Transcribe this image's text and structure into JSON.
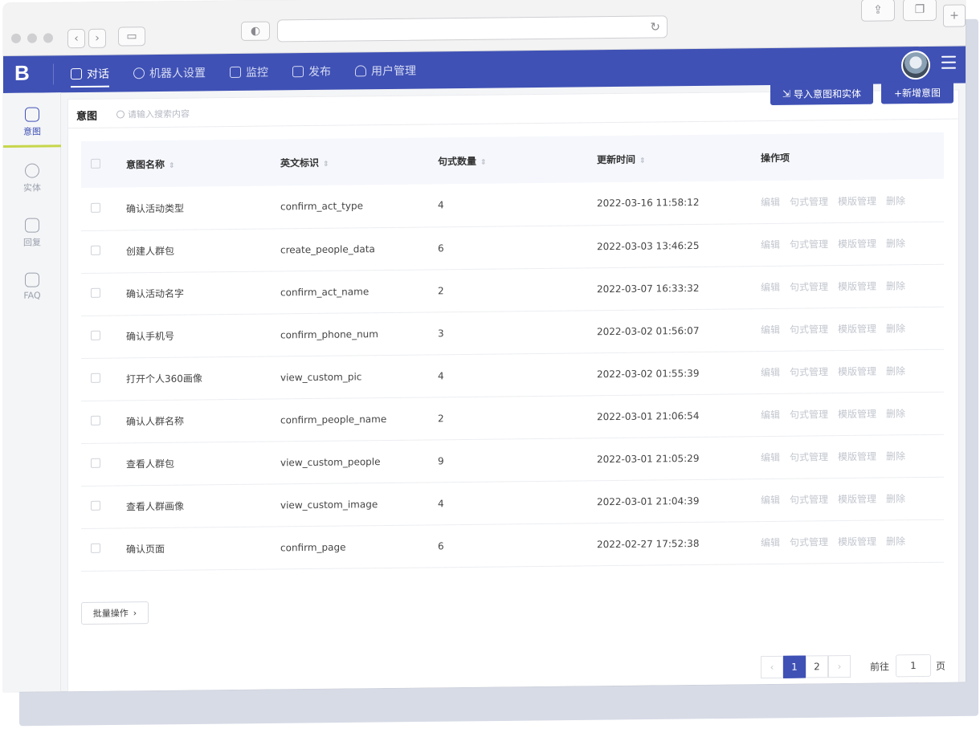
{
  "browser": {
    "address": ""
  },
  "nav": {
    "items": [
      {
        "label": "对话",
        "icon": "chat-icon",
        "active": true
      },
      {
        "label": "机器人设置",
        "icon": "robot-settings-icon",
        "active": false
      },
      {
        "label": "监控",
        "icon": "monitor-icon",
        "active": false
      },
      {
        "label": "发布",
        "icon": "publish-icon",
        "active": false
      },
      {
        "label": "用户管理",
        "icon": "user-icon",
        "active": false
      }
    ]
  },
  "sidebar": {
    "items": [
      {
        "label": "意图",
        "icon": "intent-icon",
        "active": true
      },
      {
        "label": "实体",
        "icon": "entity-icon",
        "active": false
      },
      {
        "label": "回复",
        "icon": "reply-icon",
        "active": false
      },
      {
        "label": "FAQ",
        "icon": "faq-icon",
        "active": false
      }
    ]
  },
  "page": {
    "title": "意图",
    "search_placeholder": "请输入搜索内容",
    "import_button": "导入意图和实体",
    "add_button": "+新增意图",
    "batch_button": "批量操作"
  },
  "table": {
    "headers": {
      "name": "意图名称",
      "english": "英文标识",
      "count": "句式数量",
      "updated": "更新时间",
      "ops": "操作项"
    },
    "op_labels": [
      "编辑",
      "句式管理",
      "模版管理",
      "删除"
    ],
    "rows": [
      {
        "name": "确认活动类型",
        "english": "confirm_act_type",
        "count": "4",
        "updated": "2022-03-16 11:58:12"
      },
      {
        "name": "创建人群包",
        "english": "create_people_data",
        "count": "6",
        "updated": "2022-03-03 13:46:25"
      },
      {
        "name": "确认活动名字",
        "english": "confirm_act_name",
        "count": "2",
        "updated": "2022-03-07 16:33:32"
      },
      {
        "name": "确认手机号",
        "english": "confirm_phone_num",
        "count": "3",
        "updated": "2022-03-02 01:56:07"
      },
      {
        "name": "打开个人360画像",
        "english": "view_custom_pic",
        "count": "4",
        "updated": "2022-03-02 01:55:39"
      },
      {
        "name": "确认人群名称",
        "english": "confirm_people_name",
        "count": "2",
        "updated": "2022-03-01 21:06:54"
      },
      {
        "name": "查看人群包",
        "english": "view_custom_people",
        "count": "9",
        "updated": "2022-03-01 21:05:29"
      },
      {
        "name": "查看人群画像",
        "english": "view_custom_image",
        "count": "4",
        "updated": "2022-03-01 21:04:39"
      },
      {
        "name": "确认页面",
        "english": "confirm_page",
        "count": "6",
        "updated": "2022-02-27 17:52:38"
      }
    ]
  },
  "pagination": {
    "pages": [
      "1",
      "2"
    ],
    "current": "1",
    "goto_label": "前往",
    "goto_value": "1",
    "goto_unit": "页"
  },
  "colors": {
    "brand": "#3f51b5",
    "accent_underline": "#c6d64a"
  }
}
